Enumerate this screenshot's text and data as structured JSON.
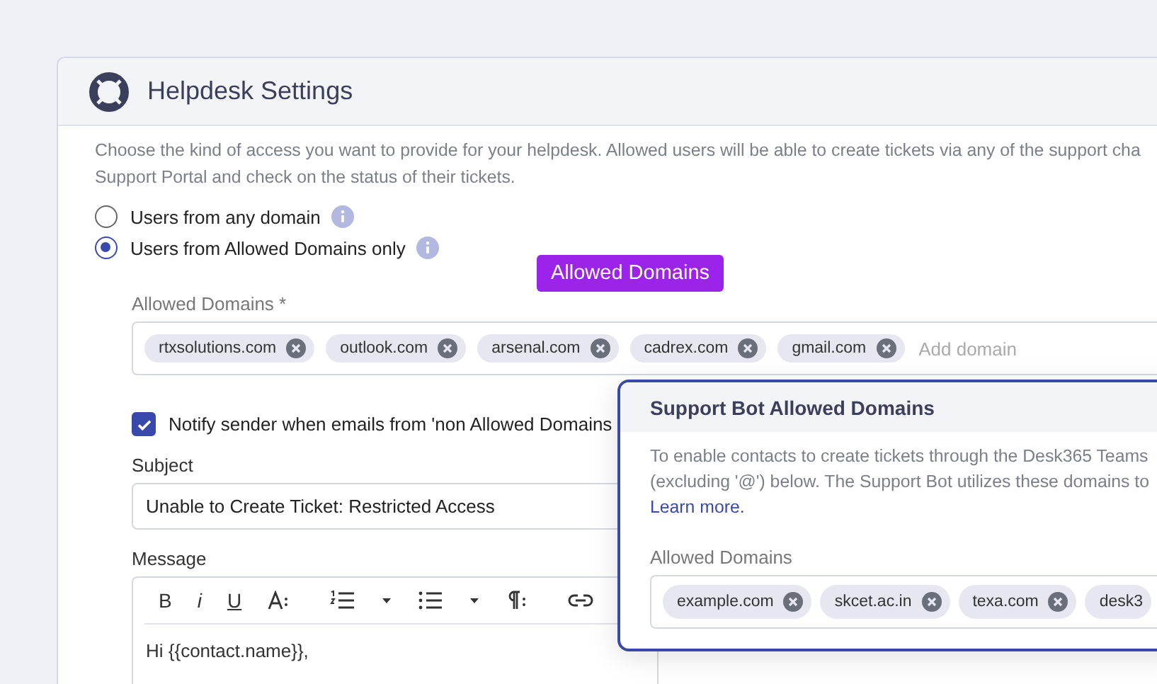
{
  "settings": {
    "title": "Helpdesk Settings",
    "description_lines": [
      "Choose the kind of access you want to provide for your helpdesk. Allowed users will be able to create tickets via any of the support cha",
      "Support Portal and check on the status of their tickets."
    ],
    "access_options": [
      {
        "label": "Users from any domain",
        "selected": false
      },
      {
        "label": "Users from Allowed Domains only",
        "selected": true
      }
    ],
    "allowed_domains": {
      "label": "Allowed Domains *",
      "placeholder": "Add domain",
      "domains": [
        "rtxsolutions.com",
        "outlook.com",
        "arsenal.com",
        "cadrex.com",
        "gmail.com"
      ]
    },
    "notify": {
      "label": "Notify sender when emails from 'non Allowed Domains",
      "checked": true
    },
    "subject": {
      "label": "Subject",
      "value": "Unable to Create Ticket: Restricted Access"
    },
    "message": {
      "label": "Message",
      "toolbar_letters": [
        "B",
        "i",
        "U"
      ],
      "body": "Hi {{contact.name}},"
    }
  },
  "highlight_badge": "Allowed Domains",
  "support_bot": {
    "title": "Support Bot Allowed Domains",
    "description_lines": [
      "To enable contacts to create tickets through the Desk365 Teams",
      "(excluding '@') below. The Support Bot utilizes these domains to"
    ],
    "link": "Learn more.",
    "field_label": "Allowed Domains",
    "domains": [
      "example.com",
      "skcet.ac.in",
      "texa.com",
      "desk3"
    ]
  }
}
